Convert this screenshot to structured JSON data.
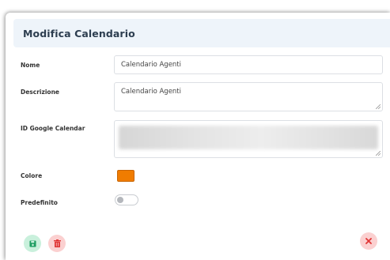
{
  "dialog": {
    "title": "Modifica Calendario"
  },
  "form": {
    "name": {
      "label": "Nome",
      "value": "Calendario Agenti"
    },
    "description": {
      "label": "Descrizione",
      "value": "Calendario Agenti"
    },
    "google_calendar_id": {
      "label": "ID Google Calendar"
    },
    "color": {
      "label": "Colore",
      "value": "#f07c00"
    },
    "default": {
      "label": "Predefinito",
      "checked": false
    }
  },
  "actions": {
    "save_icon": "floppy-disk-icon",
    "delete_icon": "trash-icon",
    "close_icon": "close-icon"
  },
  "colors": {
    "header_bg": "#eef4fa",
    "title": "#2d3e50",
    "save_bg": "#c9f0dc",
    "save_fg": "#1f9d62",
    "danger_bg": "#fbd0d0",
    "danger_fg": "#e03535"
  }
}
